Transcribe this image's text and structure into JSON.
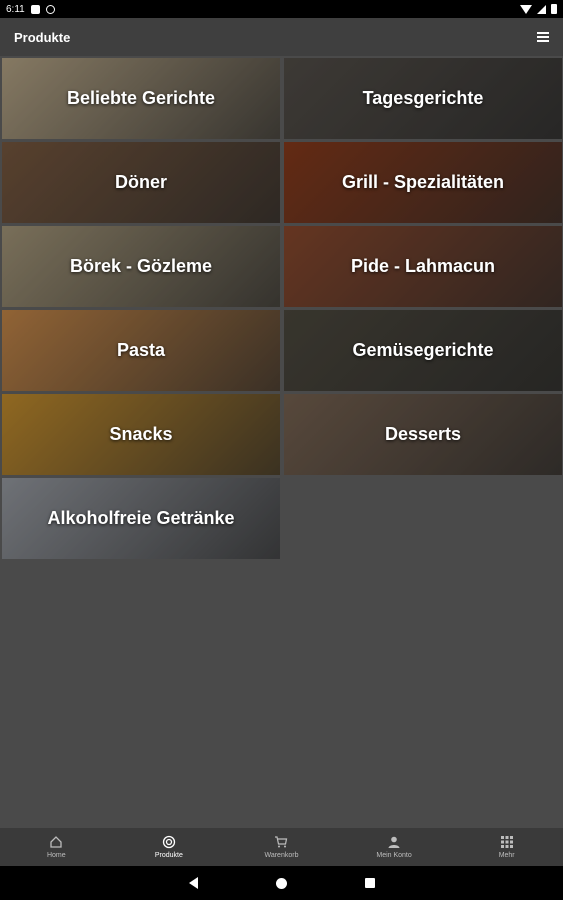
{
  "status_bar": {
    "time": "6:11"
  },
  "app_bar": {
    "title": "Produkte"
  },
  "categories": [
    {
      "label": "Beliebte Gerichte",
      "color": "#b9a889"
    },
    {
      "label": "Tagesgerichte",
      "color": "#55504a"
    },
    {
      "label": "Döner",
      "color": "#7a5a40"
    },
    {
      "label": "Grill - Spezialitäten",
      "color": "#8a3b1c"
    },
    {
      "label": "Börek - Gözleme",
      "color": "#a89a7c"
    },
    {
      "label": "Pide - Lahmacun",
      "color": "#8c4a2e"
    },
    {
      "label": "Pasta",
      "color": "#c98a4a"
    },
    {
      "label": "Gemüsegerichte",
      "color": "#4e4a3f"
    },
    {
      "label": "Snacks",
      "color": "#c7902f"
    },
    {
      "label": "Desserts",
      "color": "#7a6553"
    },
    {
      "label": "Alkoholfreie Getränke",
      "color": "#9a9ea5"
    }
  ],
  "bottom_nav": [
    {
      "label": "Home",
      "icon": "home-icon"
    },
    {
      "label": "Produkte",
      "icon": "target-icon",
      "active": true
    },
    {
      "label": "Warenkorb",
      "icon": "cart-icon"
    },
    {
      "label": "Mein Konto",
      "icon": "person-icon"
    },
    {
      "label": "Mehr",
      "icon": "grid-icon"
    }
  ]
}
